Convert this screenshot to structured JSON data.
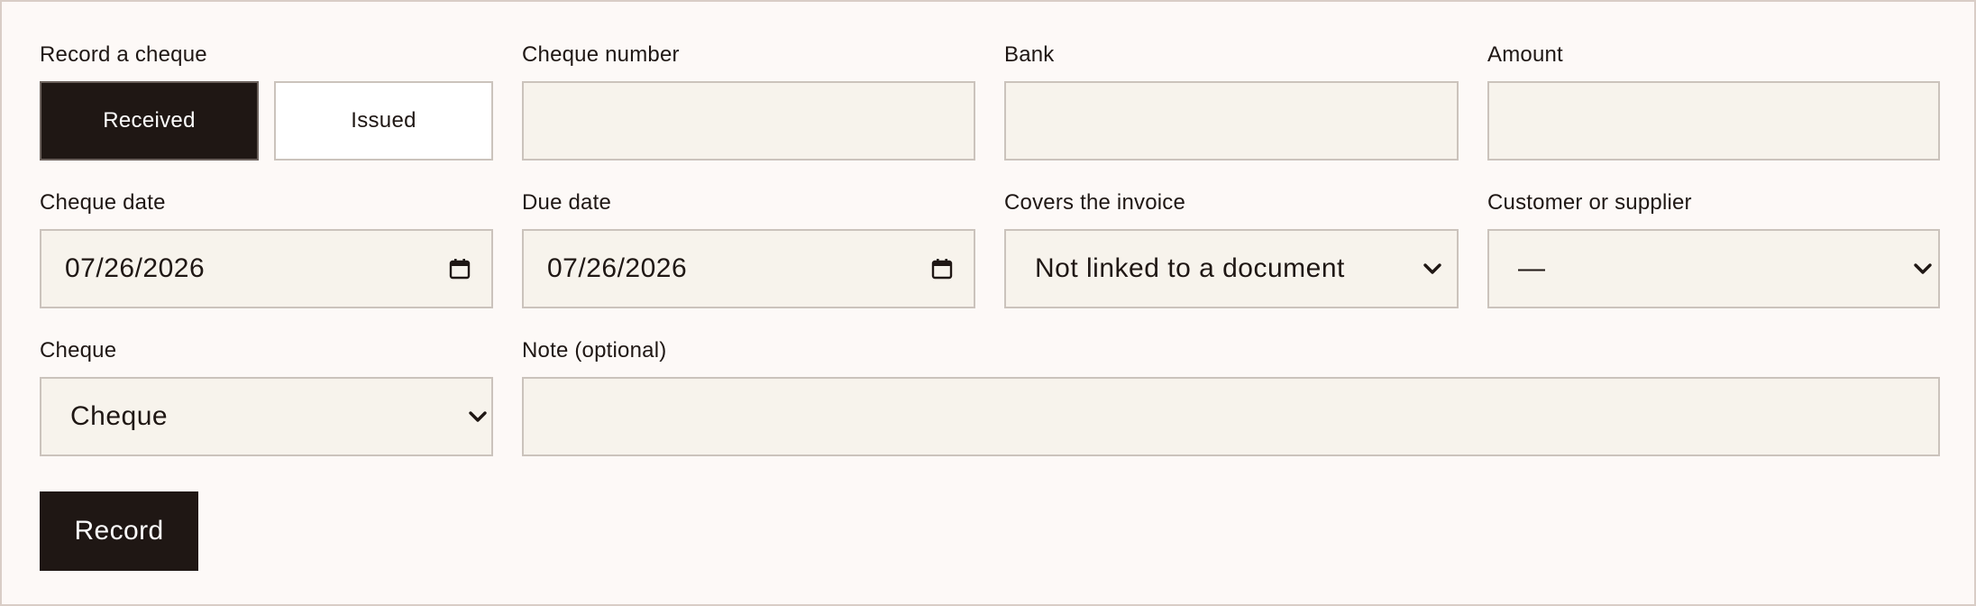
{
  "toggle": {
    "label": "Record a cheque",
    "options": [
      {
        "label": "Received",
        "selected": true
      },
      {
        "label": "Issued",
        "selected": false
      }
    ]
  },
  "cheque_number": {
    "label": "Cheque number",
    "value": ""
  },
  "bank": {
    "label": "Bank",
    "value": ""
  },
  "amount": {
    "label": "Amount",
    "value": ""
  },
  "cheque_date": {
    "label": "Cheque date",
    "value": "07/26/2026",
    "icon": "calendar-icon"
  },
  "due_date": {
    "label": "Due date",
    "value": "07/26/2026",
    "icon": "calendar-icon"
  },
  "covers_invoice": {
    "label": "Covers the invoice",
    "value": "Not linked to a document",
    "icon": "chevron-down-icon"
  },
  "customer": {
    "label": "Customer or supplier",
    "value": "—",
    "icon": "chevron-down-icon"
  },
  "cheque_type": {
    "label": "Cheque",
    "value": "Cheque",
    "icon": "chevron-down-icon"
  },
  "note": {
    "label": "Note (optional)",
    "value": ""
  },
  "record_button": {
    "label": "Record"
  },
  "colors": {
    "background": "#fdf9f7",
    "field_fill": "#f7f3ec",
    "field_border": "#cbc3bc",
    "primary": "#1f1714"
  }
}
